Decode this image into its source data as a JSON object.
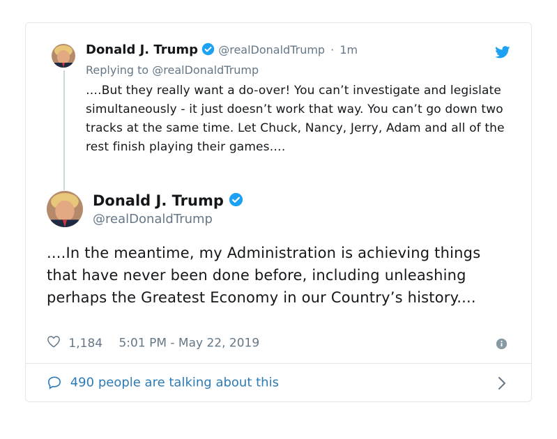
{
  "reply_tweet": {
    "author_name": "Donald J. Trump",
    "author_handle": "@realDonaldTrump",
    "separator": "·",
    "time_ago": "1m",
    "replying_to": "Replying to @realDonaldTrump",
    "text": "….But they really want a do-over! You can’t investigate and legislate simultaneously - it just doesn’t work that way. You can’t go down two tracks at the same time. Let Chuck, Nancy, Jerry, Adam and all of the rest finish playing their games…."
  },
  "main_tweet": {
    "author_name": "Donald J. Trump",
    "author_handle": "@realDonaldTrump",
    "text": "....In the meantime, my Administration is achieving things that have never been done before, including unleashing perhaps the Greatest Economy in our Country’s history....",
    "likes": "1,184",
    "timestamp": "5:01 PM - May 22, 2019"
  },
  "footer": {
    "talking_text": "490 people are talking about this"
  },
  "colors": {
    "accent": "#1da1f2",
    "link": "#2b7bb9",
    "secondary_text": "#657786",
    "border": "#e1e8ed"
  },
  "icons": [
    "verified-badge-icon",
    "twitter-bird-icon",
    "heart-icon",
    "info-icon",
    "speech-bubble-icon",
    "chevron-right-icon"
  ]
}
